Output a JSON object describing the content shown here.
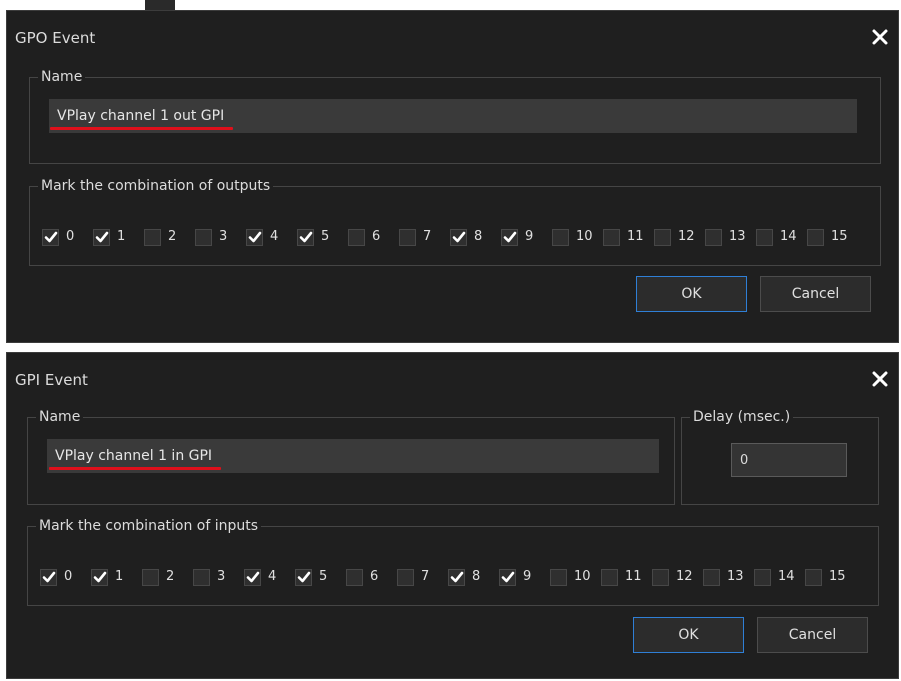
{
  "gpo_dialog": {
    "title": "GPO Event",
    "name_group_label": "Name",
    "name_value": "VPlay channel 1 out GPI",
    "outputs_group_label": "Mark the combination of outputs",
    "checkboxes": [
      {
        "label": "0",
        "checked": true
      },
      {
        "label": "1",
        "checked": true
      },
      {
        "label": "2",
        "checked": false
      },
      {
        "label": "3",
        "checked": false
      },
      {
        "label": "4",
        "checked": true
      },
      {
        "label": "5",
        "checked": true
      },
      {
        "label": "6",
        "checked": false
      },
      {
        "label": "7",
        "checked": false
      },
      {
        "label": "8",
        "checked": true
      },
      {
        "label": "9",
        "checked": true
      },
      {
        "label": "10",
        "checked": false
      },
      {
        "label": "11",
        "checked": false
      },
      {
        "label": "12",
        "checked": false
      },
      {
        "label": "13",
        "checked": false
      },
      {
        "label": "14",
        "checked": false
      },
      {
        "label": "15",
        "checked": false
      }
    ],
    "ok_label": "OK",
    "cancel_label": "Cancel"
  },
  "gpi_dialog": {
    "title": "GPI Event",
    "name_group_label": "Name",
    "name_value": "VPlay channel 1 in GPI",
    "delay_group_label": "Delay (msec.)",
    "delay_value": "0",
    "inputs_group_label": "Mark the combination of inputs",
    "checkboxes": [
      {
        "label": "0",
        "checked": true
      },
      {
        "label": "1",
        "checked": true
      },
      {
        "label": "2",
        "checked": false
      },
      {
        "label": "3",
        "checked": false
      },
      {
        "label": "4",
        "checked": true
      },
      {
        "label": "5",
        "checked": true
      },
      {
        "label": "6",
        "checked": false
      },
      {
        "label": "7",
        "checked": false
      },
      {
        "label": "8",
        "checked": true
      },
      {
        "label": "9",
        "checked": true
      },
      {
        "label": "10",
        "checked": false
      },
      {
        "label": "11",
        "checked": false
      },
      {
        "label": "12",
        "checked": false
      },
      {
        "label": "13",
        "checked": false
      },
      {
        "label": "14",
        "checked": false
      },
      {
        "label": "15",
        "checked": false
      }
    ],
    "ok_label": "OK",
    "cancel_label": "Cancel"
  },
  "colors": {
    "dialog_bg": "#1f1f1f",
    "input_bg": "#3a3a3a",
    "underline": "#e0101b",
    "ok_border": "#2f7fd6"
  }
}
